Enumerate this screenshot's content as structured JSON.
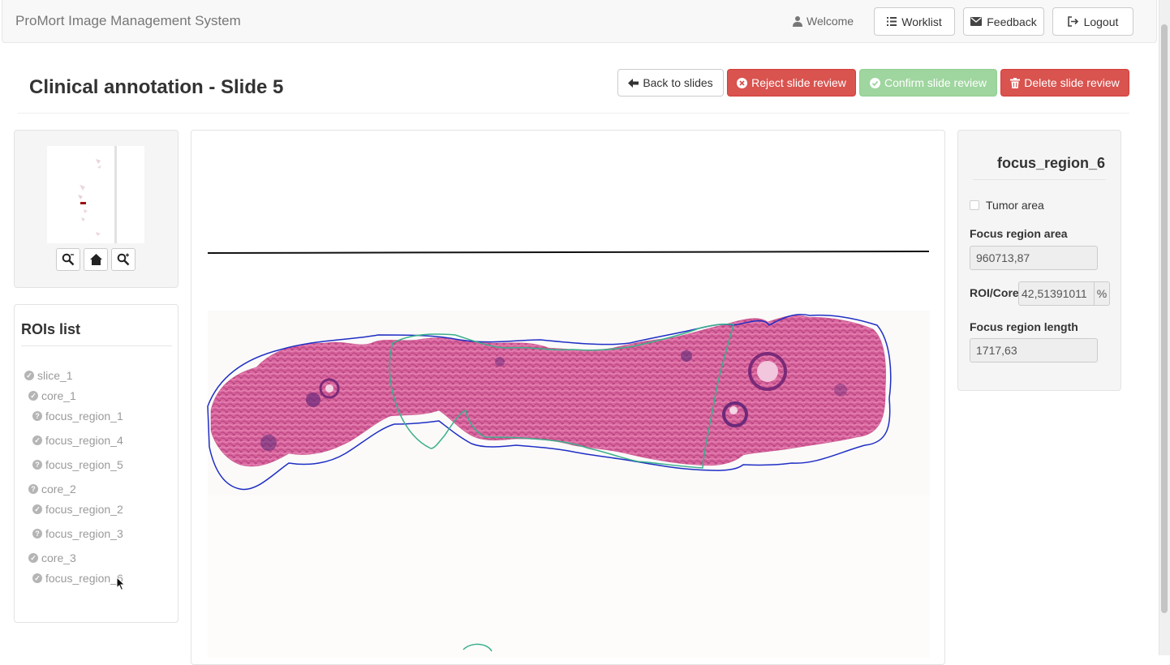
{
  "app": {
    "brand": "ProMort Image Management System",
    "welcome": "Welcome",
    "worklist": "Worklist",
    "feedback": "Feedback",
    "logout": "Logout"
  },
  "page": {
    "title": "Clinical annotation - Slide 5"
  },
  "actions": {
    "back": "Back to slides",
    "reject": "Reject slide review",
    "confirm": "Confirm slide review",
    "delete": "Delete slide review"
  },
  "rois": {
    "title": "ROIs list",
    "items": [
      {
        "label": "slice_1",
        "status": "check",
        "level": 0
      },
      {
        "label": "core_1",
        "status": "check",
        "level": 1
      },
      {
        "label": "focus_region_1",
        "status": "question",
        "level": 2
      },
      {
        "label": "focus_region_4",
        "status": "check",
        "level": 2
      },
      {
        "label": "focus_region_5",
        "status": "question",
        "level": 2
      },
      {
        "label": "core_2",
        "status": "question",
        "level": 1
      },
      {
        "label": "focus_region_2",
        "status": "check",
        "level": 2
      },
      {
        "label": "focus_region_3",
        "status": "question",
        "level": 2
      },
      {
        "label": "core_3",
        "status": "check",
        "level": 1
      },
      {
        "label": "focus_region_6",
        "status": "check",
        "level": 2
      }
    ]
  },
  "detail": {
    "title": "focus_region_6",
    "tumor_label": "Tumor area",
    "area_label": "Focus region area",
    "area_value": "960713,87",
    "ratio_label": "ROI/Core",
    "ratio_value": "42,51391011",
    "ratio_unit": "%",
    "length_label": "Focus region length",
    "length_value": "1717,63"
  },
  "colors": {
    "danger": "#d9534f",
    "success_disabled": "#9fd59f",
    "roi_core": "#2030c0",
    "roi_focus": "#3aaf8a",
    "tissue": "#d86aa0"
  }
}
